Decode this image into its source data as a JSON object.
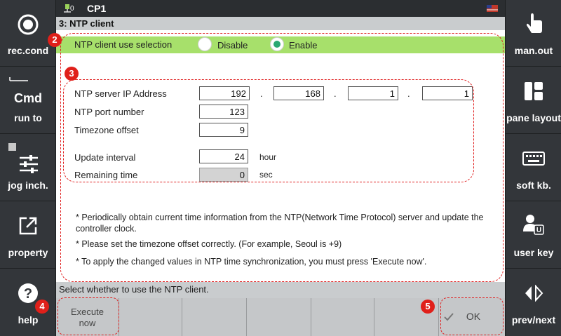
{
  "status": {
    "io_zero": "0",
    "cp": "CP1"
  },
  "title": "3: NTP client",
  "ntp_selection": {
    "label": "NTP client use selection",
    "disable": "Disable",
    "enable": "Enable",
    "selected": "Enable"
  },
  "fields": {
    "ip_label": "NTP server IP Address",
    "ip": [
      "192",
      "168",
      "1",
      "1"
    ],
    "ip_sep": ".",
    "port_label": "NTP port number",
    "port": "123",
    "tz_label": "Timezone offset",
    "tz": "9",
    "interval_label": "Update interval",
    "interval": "24",
    "interval_unit": "hour",
    "remaining_label": "Remaining time",
    "remaining": "0",
    "remaining_unit": "sec"
  },
  "notes": [
    "* Periodically obtain current time information from the NTP(Network Time Protocol) server and update the controller clock.",
    "* Please set the timezone offset correctly. (For example, Seoul is +9)",
    "* To apply the changed values in NTP time synchronization, you must press 'Execute now'."
  ],
  "message": "Select whether to use the NTP client.",
  "bottom": {
    "execute_line1": "Execute",
    "execute_line2": "now",
    "ok": "OK"
  },
  "left_menu": {
    "rec": "rec.cond",
    "cmd_icon": "Cmd",
    "run": "run to",
    "jog": "jog inch.",
    "property": "property",
    "help": "help"
  },
  "right_menu": {
    "man": "man.out",
    "pane": "pane layout",
    "soft": "soft kb.",
    "user": "user key",
    "prev": "prev/next"
  },
  "badges": [
    "2",
    "3",
    "4",
    "5"
  ],
  "colors": {
    "accent_green": "#a7e06b",
    "radio_selected": "#2aa872",
    "annotation_red": "#e0201a"
  }
}
